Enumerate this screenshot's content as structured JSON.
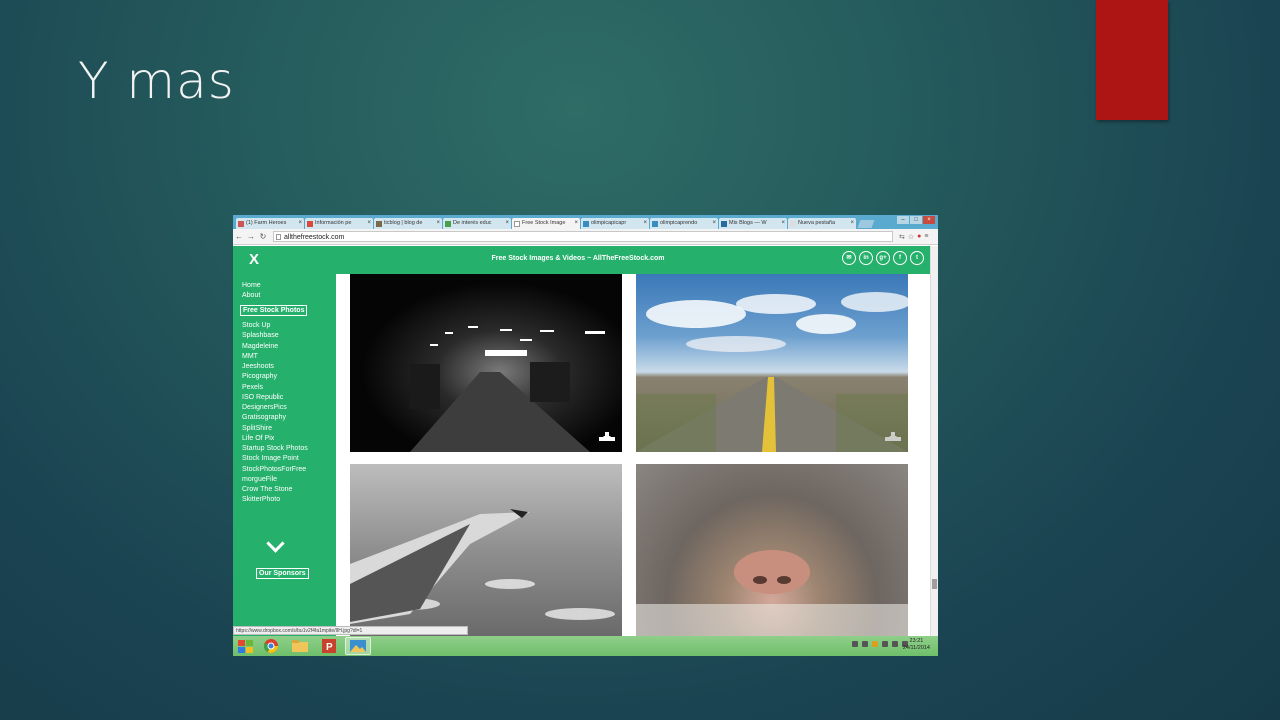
{
  "slide": {
    "title": "Y mas"
  },
  "browser": {
    "tabs": [
      {
        "label": "(1) Farm Heroes",
        "active": false
      },
      {
        "label": "Información pe",
        "active": false
      },
      {
        "label": "ticblog | blog de",
        "active": false
      },
      {
        "label": "De interés educ",
        "active": false
      },
      {
        "label": "Free Stock Image",
        "active": true
      },
      {
        "label": "olimpicapicapr",
        "active": false
      },
      {
        "label": "olimpicaprendo",
        "active": false
      },
      {
        "label": "Mis Blogs — W",
        "active": false
      },
      {
        "label": "Nueva pestaña",
        "active": false
      }
    ],
    "url": "allthefreestock.com",
    "status_url": "https://www.dropbox.com/s/bu1v2f4fa1mpite/IIH.jpg?dl=1"
  },
  "site": {
    "menu_close": "X",
    "title": "Free Stock Images & Videos ~ AllTheFreeStock.com",
    "socials": [
      "✉",
      "in",
      "g+",
      "f",
      "t"
    ],
    "sidebar": {
      "top_links": [
        "Home",
        "About"
      ],
      "section_label": "Free Stock Photos",
      "links": [
        "Stock Up",
        "Splashbase",
        "Magdeleine",
        "MMT",
        "Jeeshoots",
        "Picography",
        "Pexels",
        "ISO Republic",
        "DesignersPics",
        "Gratisography",
        "SplitShire",
        "Life Of Pix",
        "Startup Stock Photos",
        "Stock Image Point",
        "StockPhotosForFree",
        "morgueFile",
        "Crow The Stone",
        "SkitterPhoto"
      ],
      "sponsors_label": "Our Sponsors"
    },
    "photos": [
      {
        "name": "garage-tunnel",
        "has_download": true
      },
      {
        "name": "desert-road",
        "has_download": true
      },
      {
        "name": "airplane-wing",
        "has_download": false
      },
      {
        "name": "cat-nose",
        "has_download": false
      }
    ]
  },
  "taskbar": {
    "time": "23:21",
    "date": "24/11/2014"
  }
}
